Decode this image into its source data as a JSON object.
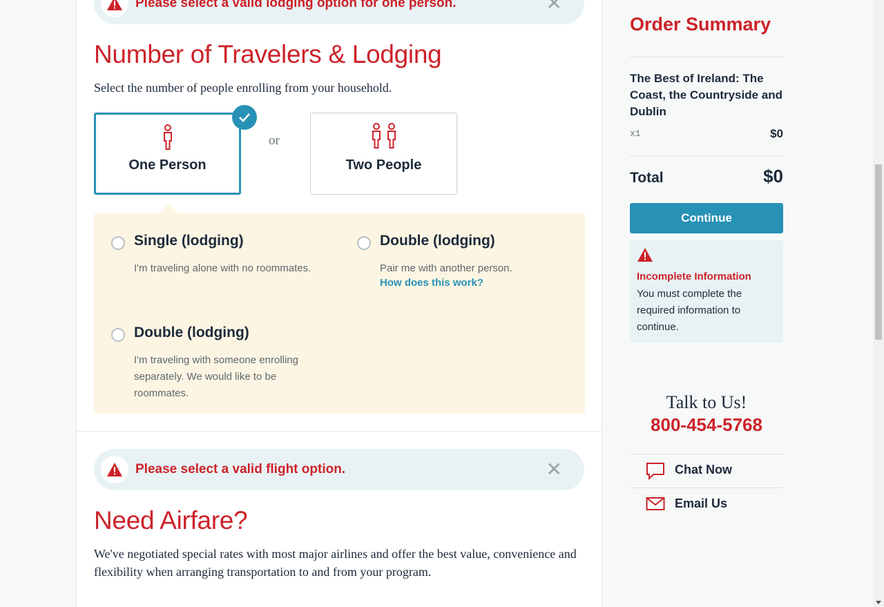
{
  "alerts": {
    "lodging_error": "Please select a valid lodging option for one person.",
    "flight_error": "Please select a valid flight option.",
    "close_glyph": "✕"
  },
  "travelers": {
    "heading": "Number of Travelers & Lodging",
    "intro": "Select the number of people enrolling from your household.",
    "one_person": "One Person",
    "or": "or",
    "two_people": "Two People",
    "selected": "One Person"
  },
  "lodging": {
    "options": [
      {
        "title": "Single (lodging)",
        "desc": "I'm traveling alone with no roommates."
      },
      {
        "title": "Double (lodging)",
        "desc": "Pair me with another person.",
        "link": "How does this work?"
      },
      {
        "title": "Double (lodging)",
        "desc": "I'm traveling with someone enrolling separately. We would like to be roommates."
      }
    ]
  },
  "airfare": {
    "heading": "Need Airfare?",
    "text": "We've negotiated special rates with most major airlines and offer the best value, convenience and flexibility when arranging transportation to and from your program."
  },
  "summary": {
    "heading": "Order Summary",
    "trip_title": "The Best of Ireland: The Coast, the Countryside and Dublin",
    "qty": "x1",
    "price": "$0",
    "total_label": "Total",
    "total_value": "$0",
    "continue_label": "Continue",
    "warning_title": "Incomplete Information",
    "warning_text": "You must complete the required information to continue."
  },
  "contact": {
    "talk": "Talk to Us!",
    "phone": "800-454-5768",
    "chat": "Chat Now",
    "email": "Email Us"
  },
  "colors": {
    "accent_red": "#cc2229",
    "accent_blue": "#2891b6",
    "lodging_bg": "#fdf5e3",
    "alert_bg": "#e8f2f4"
  },
  "icons": [
    "warning-icon",
    "close-icon",
    "person-icon",
    "two-people-icon",
    "checkmark-icon",
    "chat-icon",
    "email-icon"
  ]
}
